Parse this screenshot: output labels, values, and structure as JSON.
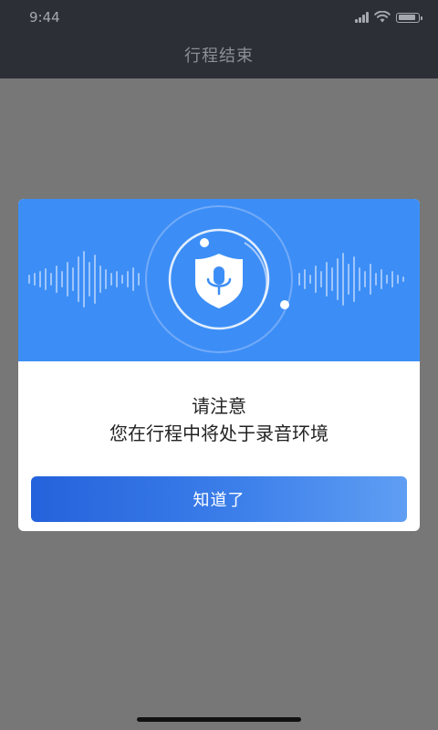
{
  "status_bar": {
    "time": "9:44",
    "icons": [
      "signal-icon",
      "wifi-icon",
      "battery-icon"
    ]
  },
  "nav": {
    "title": "行程结束"
  },
  "dialog": {
    "header_icon": "shield-microphone-icon",
    "message_line1": "请注意",
    "message_line2": "您在行程中将处于录音环境",
    "button_label": "知道了"
  },
  "colors": {
    "header_bg": "#3c8ef6",
    "button_start": "#2462db",
    "button_end": "#5f9ef3",
    "nav_bg": "#2c2f36"
  }
}
